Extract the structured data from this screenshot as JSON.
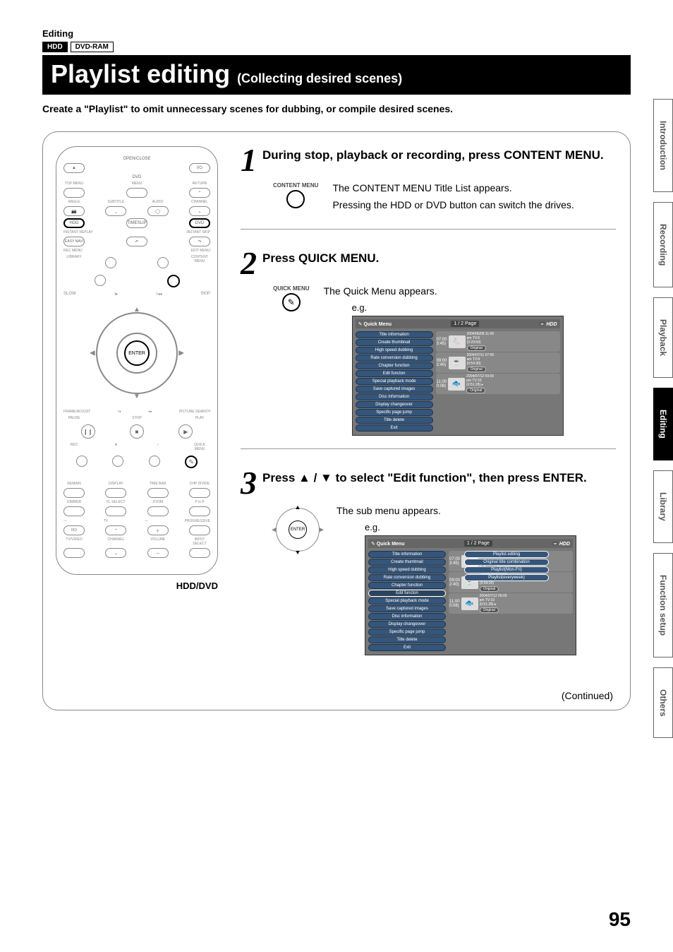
{
  "header": {
    "section": "Editing",
    "tags": {
      "hdd": "HDD",
      "dvdram": "DVD-RAM"
    },
    "title": "Playlist editing",
    "subtitle": "(Collecting desired scenes)",
    "intro": "Create a \"Playlist\" to omit unnecessary scenes for dubbing, or compile desired scenes."
  },
  "remote": {
    "open_close": "OPEN/CLOSE",
    "dvd": "DVD",
    "top_menu": "TOP MENU",
    "menu": "MENU",
    "return": "RETURN",
    "angle": "ANGLE",
    "subtitle": "SUBTITLE",
    "audio": "AUDIO",
    "channel": "CHANNEL",
    "hdd": "HDD",
    "timeslip": "TIMESLIP",
    "dvd_btn": "DVD",
    "instant_replay": "INSTANT REPLAY",
    "instant_skip": "INSTANT SKIP",
    "easy_navi": "EASY NAVI",
    "rec_menu": "REC MENU",
    "edit_menu": "EDIT MENU",
    "library": "LIBRARY",
    "content_menu": "CONTENT MENU",
    "slow": "SLOW",
    "skip": "SKIP",
    "enter": "ENTER",
    "frame_adjust": "FRAME/ADJUST",
    "picture_search": "PICTURE SEARCH",
    "pause": "PAUSE",
    "stop": "STOP",
    "play": "PLAY",
    "rec": "REC",
    "quick_menu_lbl": "QUICK MENU",
    "remain": "REMAIN",
    "display": "DISPLAY",
    "time_bar": "TIME BAR",
    "chp_divide": "CHP DIVIDE",
    "dimmer": "DIMMER",
    "fl_select": "FL SELECT",
    "zoom": "ZOOM",
    "pinp": "P in P",
    "tv": "TV",
    "progressive": "PROGRESSIVE",
    "tvvideo": "TV/VIDEO",
    "channel2": "CHANNEL",
    "volume": "VOLUME",
    "input_select": "INPUT SELECT",
    "hdd_dvd_label": "HDD/DVD"
  },
  "steps": [
    {
      "num": "1",
      "title": "During stop, playback or recording, press CONTENT MENU.",
      "icon_label": "CONTENT MENU",
      "lines": [
        "The CONTENT MENU Title List appears.",
        "Pressing the HDD or DVD button can switch the drives."
      ]
    },
    {
      "num": "2",
      "title": "Press QUICK MENU.",
      "icon_label": "QUICK MENU",
      "lines": [
        "The Quick Menu appears."
      ],
      "eg": "e.g."
    },
    {
      "num": "3",
      "title": "Press ▲ / ▼ to select \"Edit function\", then press ENTER.",
      "lines": [
        "The sub menu appears."
      ],
      "eg": "e.g.",
      "enter": "ENTER"
    }
  ],
  "osd": {
    "quick_menu_title": "Quick Menu",
    "page": "1 / 2  Page",
    "hdd": "HDD",
    "menu_items": [
      "Title information",
      "Create thumbnail",
      "High speed dubbing",
      "Rate conversion dubbing",
      "Chapter function",
      "Edit functon",
      "Special playback mode",
      "Save captured images",
      "Disc information",
      "Display changeover",
      "Specific page jump",
      "Title delete",
      "Exit"
    ],
    "submenu_items": [
      "Playlist editing",
      "Original title combination",
      "Playlist(Mon-Fri)",
      "Playlist(everyweek)"
    ],
    "rows": [
      {
        "t1": "07:00",
        "t2": "3:45)",
        "date": "2004/06/08 11:00",
        "ch": "pm  TV:6",
        "dur": "(0:29:50)",
        "tag": "Original"
      },
      {
        "t1": "09:00",
        "t2": "2:40)",
        "date": "2004/07/11 07:00",
        "ch": "am  TV:8",
        "dur": "(0:54:30)",
        "tag": "Original"
      },
      {
        "t1": "11:00",
        "t2": "0:08)",
        "date": "2004/07/12 09:00",
        "ch": "pm  TV:10",
        "dur": "(0:51:28)",
        "tag": "Original"
      }
    ]
  },
  "continued": "(Continued)",
  "side_tabs": [
    "Introduction",
    "Recording",
    "Playback",
    "Editing",
    "Library",
    "Function setup",
    "Others"
  ],
  "page_number": "95"
}
